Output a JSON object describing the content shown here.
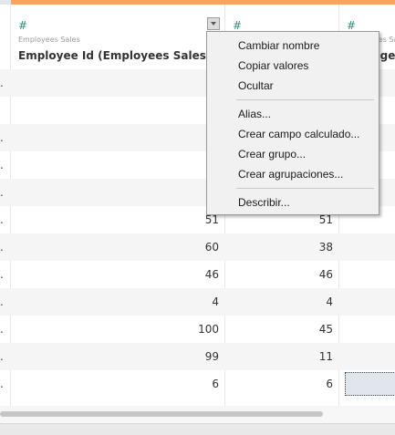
{
  "colors": {
    "accent_band_left": "#e3e6ea",
    "accent_band": "#f2a565",
    "row_stripe": "#f5f5f5",
    "selection_fill": "#e1e6ec",
    "icon_green": "#2e8b74"
  },
  "columns": [
    {
      "icon": "hash-icon",
      "icon_glyph": "#",
      "source": "Employees Sales",
      "name": "Employee Id (Employees Sales)",
      "has_dropdown": true
    },
    {
      "icon": "hash-icon",
      "icon_glyph": "#",
      "source": "",
      "name": "",
      "has_dropdown": false
    },
    {
      "icon": "hash-icon",
      "icon_glyph": "#",
      "source": "Employees Sales",
      "name": "Manager",
      "has_dropdown": false
    }
  ],
  "rows": [
    {
      "marker": ".",
      "col1": "",
      "col2": ""
    },
    {
      "marker": "",
      "col1": "",
      "col2": ""
    },
    {
      "marker": ".",
      "col1": "",
      "col2": ""
    },
    {
      "marker": ".",
      "col1": "",
      "col2": ""
    },
    {
      "marker": ".",
      "col1": "",
      "col2": ""
    },
    {
      "marker": ".",
      "col1": "51",
      "col2": "51"
    },
    {
      "marker": ".",
      "col1": "60",
      "col2": "38"
    },
    {
      "marker": ".",
      "col1": "46",
      "col2": "46"
    },
    {
      "marker": ".",
      "col1": "4",
      "col2": "4"
    },
    {
      "marker": ".",
      "col1": "100",
      "col2": "45"
    },
    {
      "marker": ".",
      "col1": "99",
      "col2": "11"
    },
    {
      "marker": ".",
      "col1": "6",
      "col2": "6"
    }
  ],
  "selected_row": 11,
  "context_menu": {
    "groups": [
      [
        "Cambiar nombre",
        "Copiar valores",
        "Ocultar"
      ],
      [
        "Alias...",
        "Crear campo calculado...",
        "Crear grupo...",
        "Crear agrupaciones..."
      ],
      [
        "Describir..."
      ]
    ]
  }
}
